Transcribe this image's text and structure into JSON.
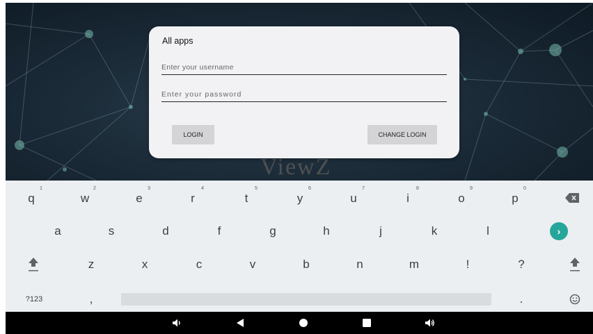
{
  "dialog": {
    "title": "All apps",
    "username_placeholder": "Enter your username",
    "password_placeholder": "Enter your password",
    "login_label": "LOGIN",
    "change_login_label": "CHANGE LOGIN"
  },
  "watermark": "ViewZ",
  "keyboard": {
    "row1": [
      {
        "char": "q",
        "hint": "1"
      },
      {
        "char": "w",
        "hint": "2"
      },
      {
        "char": "e",
        "hint": "3"
      },
      {
        "char": "r",
        "hint": "4"
      },
      {
        "char": "t",
        "hint": "5"
      },
      {
        "char": "y",
        "hint": "6"
      },
      {
        "char": "u",
        "hint": "7"
      },
      {
        "char": "i",
        "hint": "8"
      },
      {
        "char": "o",
        "hint": "9"
      },
      {
        "char": "p",
        "hint": "0"
      }
    ],
    "row2": [
      "a",
      "s",
      "d",
      "f",
      "g",
      "h",
      "j",
      "k",
      "l"
    ],
    "row3": [
      "z",
      "x",
      "c",
      "v",
      "b",
      "n",
      "m",
      "!",
      "?"
    ],
    "symbols_label": "?123",
    "comma": ",",
    "period": "."
  },
  "icons": {
    "backspace": "backspace-icon",
    "enter": "enter-arrow-icon",
    "shift": "shift-icon",
    "emoji": "emoji-icon",
    "volume_down": "volume-down-icon",
    "back": "back-icon",
    "home": "home-icon",
    "recents": "recents-icon",
    "volume_up": "volume-up-icon"
  },
  "colors": {
    "enter_key": "#26a69a",
    "keyboard_bg": "#eceff1",
    "dialog_bg": "#f2f2f4",
    "navbar_bg": "#000000"
  }
}
